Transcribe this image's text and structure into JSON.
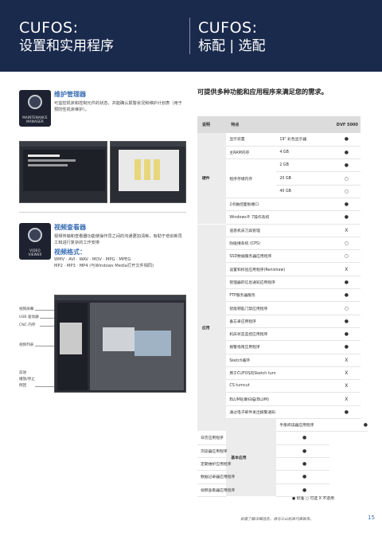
{
  "header": {
    "left_title": "CUFOS:",
    "left_sub": "设置和实用程序",
    "right_title": "CUFOS:",
    "right_sub": "标配 | 选配"
  },
  "maintenance": {
    "icon_caption_line1": "MAINTENANCE",
    "icon_caption_line2": "MANAGER",
    "title": "维护管理器",
    "desc": "可监控机床和控制元件的状态，并能确认报警状况和维护计划表（用于预防性机床维护）。"
  },
  "video": {
    "icon_caption_line1": "VIDEO",
    "icon_caption_line2": "VIEWER",
    "title": "视频查看器",
    "desc": "视频传输和查看器功能使操作员之间的沟通更加清晰，有助于培训新员工和进行复杂的工作安排",
    "formats_title": "视频格式：",
    "formats_line1": "WMV · AVI · WAV · MOV · MPG · MPEG",
    "formats_line2": "MP2 · MP3 · MP4 (与Windows Media打开文件相同)",
    "callouts": [
      "视频屏幕",
      "USB 驱动器",
      "CNC 内存",
      "视频列表",
      "前进",
      "播放/停止",
      "倒回"
    ]
  },
  "table": {
    "title": "可提供多种功能和应用程序来满足您的需求。",
    "headers": [
      "说明",
      "特点",
      "",
      "DVF 5000"
    ],
    "rows": [
      {
        "cat": "硬件",
        "span": 7,
        "feature": "显示装置",
        "spec": "19\" 彩色显示器",
        "val": "●"
      },
      {
        "feature": "主RAM内存",
        "spec": "4 GB",
        "val": "●"
      },
      {
        "feature": "程序存储内存",
        "span_feature": 3,
        "spec": "2 GB",
        "val": "●"
      },
      {
        "spec": "20 GB",
        "val": "○"
      },
      {
        "spec": "40 GB",
        "val": "○"
      },
      {
        "feature": "2点触控面板端口",
        "spec": "",
        "val": "●"
      },
      {
        "feature": "Windows® 7操作系统",
        "spec": "",
        "val": "●"
      },
      {
        "cat": "应用",
        "span": 16,
        "feature": "道思机床刀具管理",
        "spec": "",
        "val": "X"
      },
      {
        "feature": "防碰撞系统 (CPS)",
        "spec": "",
        "val": "○"
      },
      {
        "feature": "SSD数据服务器应用程序",
        "spec": "",
        "val": "○"
      },
      {
        "feature": "设置和校验应用程序(Renishaw)",
        "spec": "",
        "val": "X"
      },
      {
        "feature": "管理器的信息通知应用程序",
        "spec": "",
        "val": "●"
      },
      {
        "feature": "FTP服务器服务",
        "spec": "",
        "val": "●"
      },
      {
        "feature": "智能钥匙门禁应用程序",
        "spec": "",
        "val": "○"
      },
      {
        "feature": "备忘录应用程序",
        "spec": "",
        "val": "●"
      },
      {
        "feature": "机床状态监控应用程序",
        "spec": "",
        "val": "●"
      },
      {
        "feature": "报警指南应用程序",
        "spec": "",
        "val": "●"
      },
      {
        "feature": "Sketch循环",
        "spec": "",
        "val": "X"
      },
      {
        "feature": "用于CUFOS的Sketch turn",
        "spec": "",
        "val": "X"
      },
      {
        "feature": "CS turncut",
        "spec": "",
        "val": "X"
      },
      {
        "feature": "BLUM轮廓扫描(BLUM)",
        "spec": "",
        "val": "X"
      },
      {
        "feature": "通过电子邮件发出报警通知",
        "spec": "",
        "val": "●"
      },
      {
        "cat": "基本应用",
        "span": 6,
        "feature": "手册阅读器应用程序",
        "spec": "",
        "val": "●"
      },
      {
        "feature": "日历应用程序",
        "spec": "",
        "val": "●"
      },
      {
        "feature": "浏览器应用程序",
        "spec": "",
        "val": "●"
      },
      {
        "feature": "定期维护应用程序",
        "spec": "",
        "val": "●"
      },
      {
        "feature": "数据记录器应用程序",
        "spec": "",
        "val": "●"
      },
      {
        "feature": "视频查看器应用程序",
        "spec": "",
        "val": "●"
      }
    ]
  },
  "legend": "● 标准   ○ 可选   X 不适用",
  "footer_note": "如需了解详细信息，请与斗山机床代表联系。",
  "page_number": "15"
}
